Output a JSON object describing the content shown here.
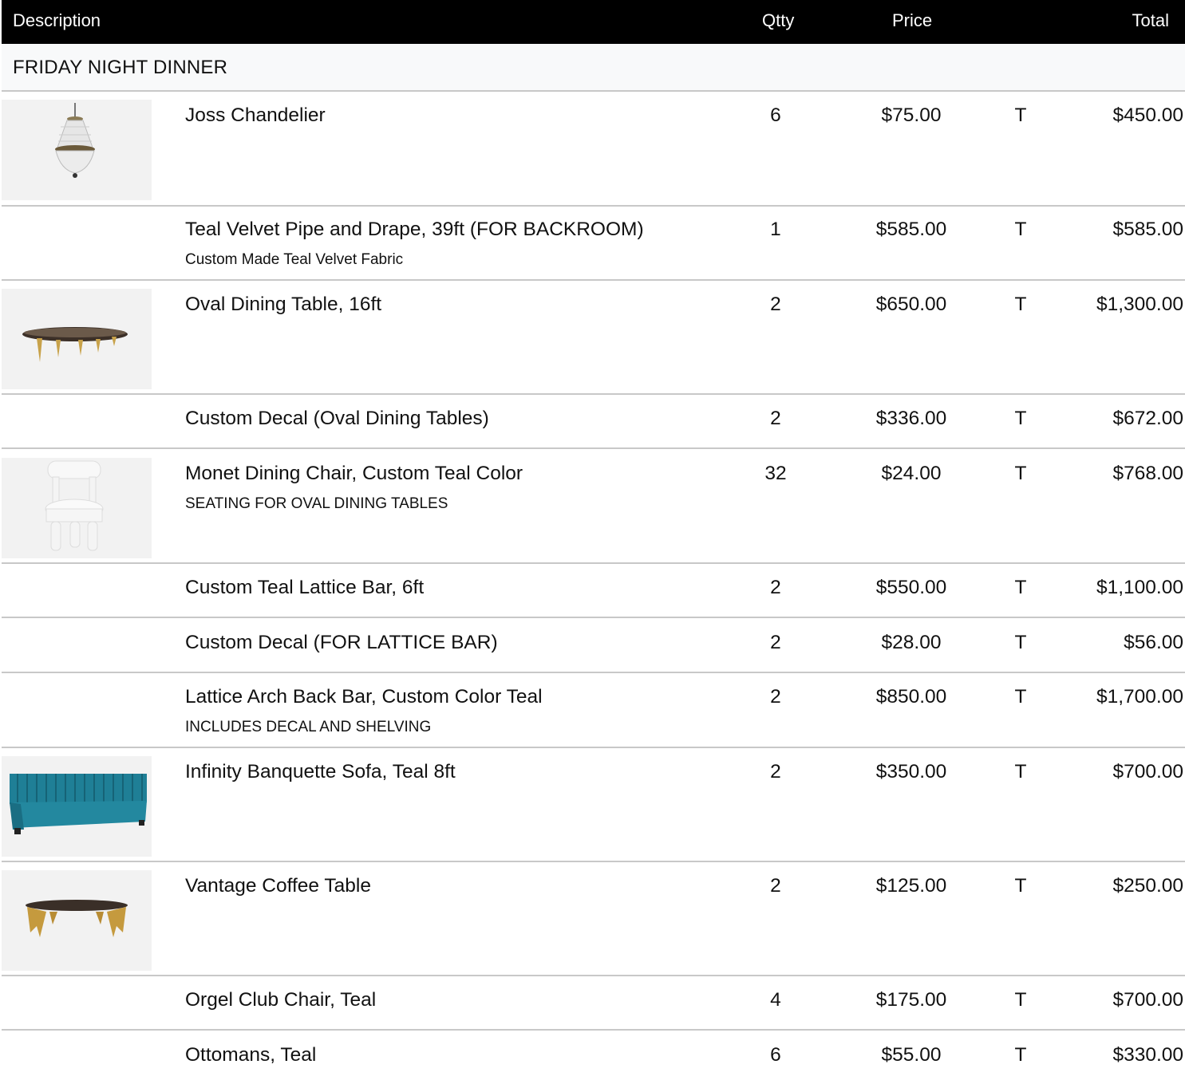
{
  "header": {
    "description": "Description",
    "qty": "Qtty",
    "price": "Price",
    "total": "Total"
  },
  "section": {
    "title": "FRIDAY NIGHT DINNER"
  },
  "items": [
    {
      "name": "Joss Chandelier",
      "note": "",
      "qty": "6",
      "price": "$75.00",
      "tax": "T",
      "total": "$450.00",
      "image": "chandelier-icon"
    },
    {
      "name": "Teal Velvet Pipe and Drape, 39ft (FOR BACKROOM)",
      "note": "Custom Made Teal Velvet Fabric",
      "qty": "1",
      "price": "$585.00",
      "tax": "T",
      "total": "$585.00",
      "image": ""
    },
    {
      "name": "Oval Dining Table, 16ft",
      "note": "",
      "qty": "2",
      "price": "$650.00",
      "tax": "T",
      "total": "$1,300.00",
      "image": "oval-table-icon"
    },
    {
      "name": "Custom Decal (Oval Dining Tables)",
      "note": "",
      "qty": "2",
      "price": "$336.00",
      "tax": "T",
      "total": "$672.00",
      "image": ""
    },
    {
      "name": "Monet Dining Chair, Custom Teal Color",
      "note": "SEATING FOR OVAL DINING TABLES",
      "qty": "32",
      "price": "$24.00",
      "tax": "T",
      "total": "$768.00",
      "image": "dining-chair-icon"
    },
    {
      "name": "Custom Teal Lattice Bar, 6ft",
      "note": "",
      "qty": "2",
      "price": "$550.00",
      "tax": "T",
      "total": "$1,100.00",
      "image": ""
    },
    {
      "name": "Custom Decal (FOR LATTICE BAR)",
      "note": "",
      "qty": "2",
      "price": "$28.00",
      "tax": "T",
      "total": "$56.00",
      "image": ""
    },
    {
      "name": "Lattice Arch Back Bar, Custom Color Teal",
      "note": "INCLUDES DECAL AND SHELVING",
      "qty": "2",
      "price": "$850.00",
      "tax": "T",
      "total": "$1,700.00",
      "image": ""
    },
    {
      "name": "Infinity Banquette Sofa, Teal 8ft",
      "note": "",
      "qty": "2",
      "price": "$350.00",
      "tax": "T",
      "total": "$700.00",
      "image": "banquette-sofa-icon"
    },
    {
      "name": "Vantage Coffee Table",
      "note": "",
      "qty": "2",
      "price": "$125.00",
      "tax": "T",
      "total": "$250.00",
      "image": "coffee-table-icon"
    },
    {
      "name": "Orgel Club Chair, Teal",
      "note": "",
      "qty": "4",
      "price": "$175.00",
      "tax": "T",
      "total": "$700.00",
      "image": ""
    },
    {
      "name": "Ottomans, Teal",
      "note": "",
      "qty": "6",
      "price": "$55.00",
      "tax": "T",
      "total": "$330.00",
      "image": ""
    }
  ],
  "colors": {
    "header_bg": "#000000",
    "section_bg": "#f8f9fa",
    "divider": "#c8c8c8",
    "teal": "#1f7f96"
  }
}
